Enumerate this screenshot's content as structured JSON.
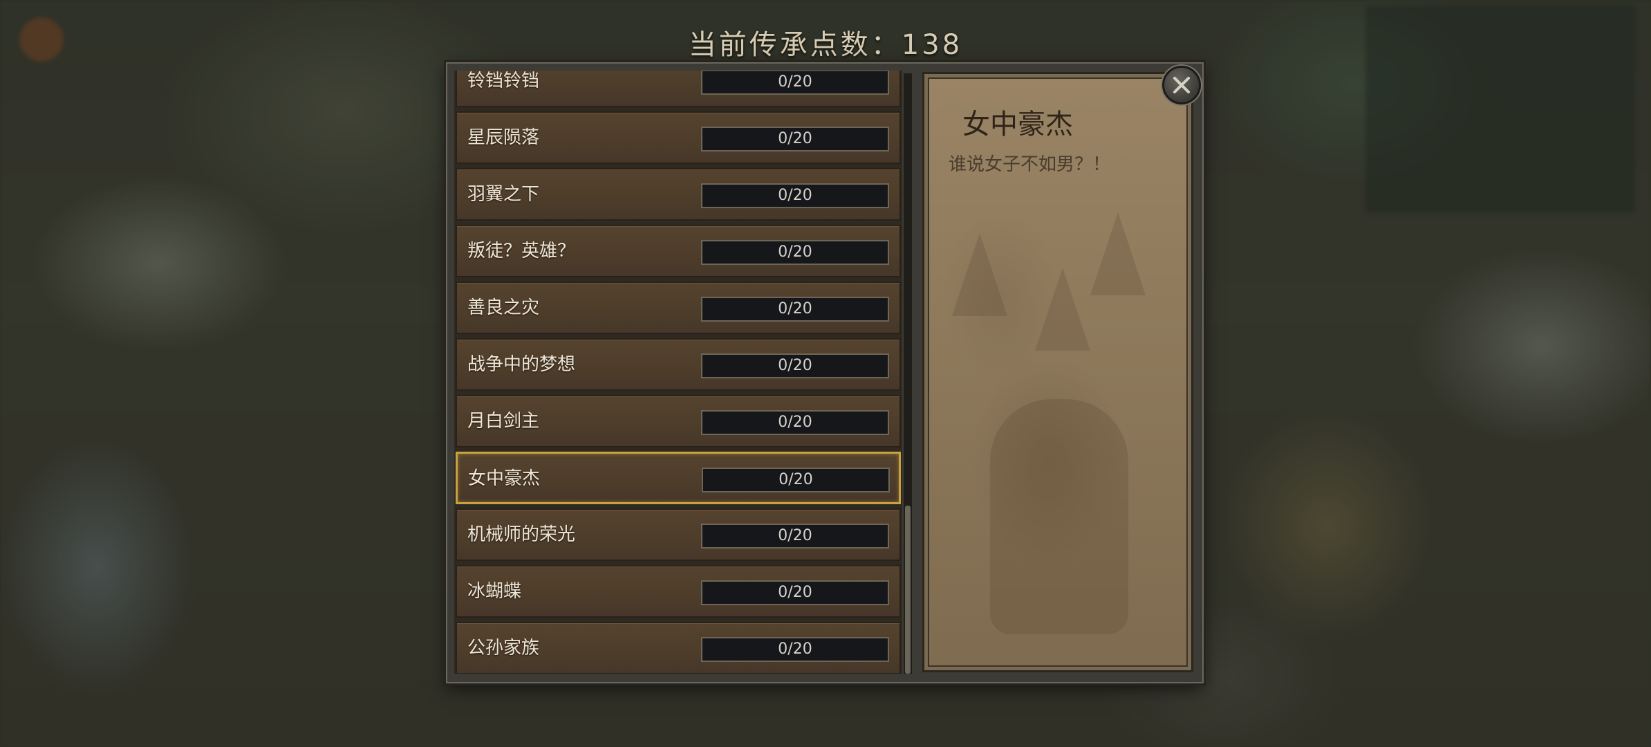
{
  "header": {
    "points_text": "当前传承点数：138"
  },
  "legacy_list": {
    "items": [
      {
        "name": "铃铛铃铛",
        "progress": "0/20",
        "value": 0,
        "max": 20,
        "selected": false
      },
      {
        "name": "星辰陨落",
        "progress": "0/20",
        "value": 0,
        "max": 20,
        "selected": false
      },
      {
        "name": "羽翼之下",
        "progress": "0/20",
        "value": 0,
        "max": 20,
        "selected": false
      },
      {
        "name": "叛徒？英雄？",
        "progress": "0/20",
        "value": 0,
        "max": 20,
        "selected": false
      },
      {
        "name": "善良之灾",
        "progress": "0/20",
        "value": 0,
        "max": 20,
        "selected": false
      },
      {
        "name": "战争中的梦想",
        "progress": "0/20",
        "value": 0,
        "max": 20,
        "selected": false
      },
      {
        "name": "月白剑主",
        "progress": "0/20",
        "value": 0,
        "max": 20,
        "selected": false
      },
      {
        "name": "女中豪杰",
        "progress": "0/20",
        "value": 0,
        "max": 20,
        "selected": true
      },
      {
        "name": "机械师的荣光",
        "progress": "0/20",
        "value": 0,
        "max": 20,
        "selected": false
      },
      {
        "name": "冰蝴蝶",
        "progress": "0/20",
        "value": 0,
        "max": 20,
        "selected": false
      },
      {
        "name": "公孙家族",
        "progress": "0/20",
        "value": 0,
        "max": 20,
        "selected": false
      }
    ]
  },
  "scroll": {
    "thumb_start": 0.72,
    "thumb_length": 0.28
  },
  "detail": {
    "title": "女中豪杰",
    "description": "谁说女子不如男？！"
  },
  "colors": {
    "selected_border": "#c9a23d",
    "row_background": "#4e3d2a",
    "parchment": "#8f7a5c"
  },
  "icons": {
    "close": "close-icon"
  }
}
